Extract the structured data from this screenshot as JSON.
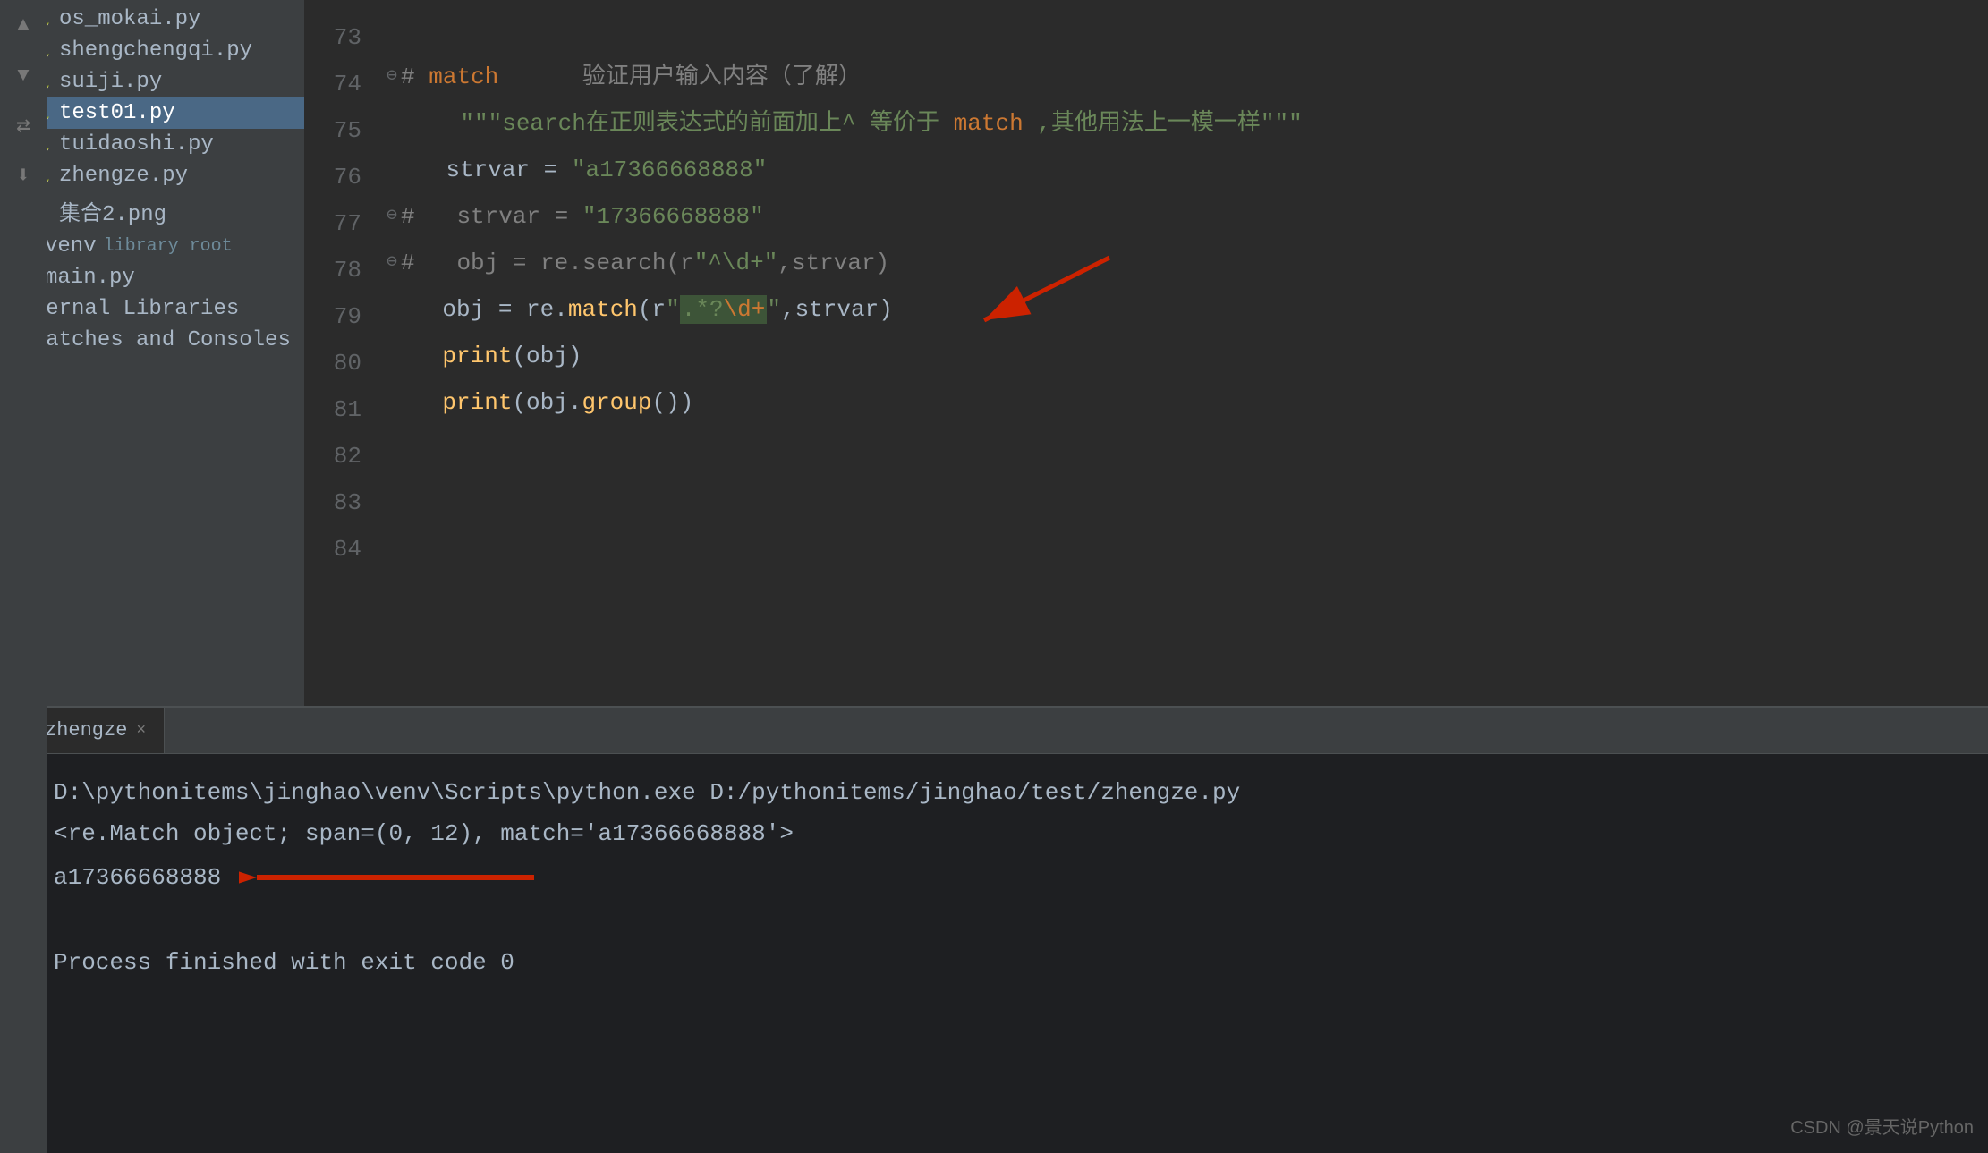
{
  "sidebar": {
    "items": [
      {
        "id": "os-mokai",
        "label": "os_mokai.py",
        "type": "py",
        "indent": 1
      },
      {
        "id": "shengchengqi",
        "label": "shengchengqi.py",
        "type": "py",
        "indent": 1
      },
      {
        "id": "suiji",
        "label": "suiji.py",
        "type": "py",
        "indent": 1
      },
      {
        "id": "test01",
        "label": "test01.py",
        "type": "py",
        "indent": 1,
        "selected": true
      },
      {
        "id": "tuidaoshi",
        "label": "tuidaoshi.py",
        "type": "py",
        "indent": 1
      },
      {
        "id": "zhengze",
        "label": "zhengze.py",
        "type": "py",
        "indent": 1
      },
      {
        "id": "jijhe2",
        "label": "集合2.png",
        "type": "png",
        "indent": 1
      },
      {
        "id": "venv",
        "label": "venv",
        "type": "folder",
        "sublabel": "library root",
        "indent": 0
      },
      {
        "id": "main",
        "label": "main.py",
        "type": "py",
        "indent": 0
      },
      {
        "id": "external-libraries",
        "label": "External Libraries",
        "type": "folder-external",
        "indent": 0
      },
      {
        "id": "scratches",
        "label": "Scratches and Consoles",
        "type": "folder-external",
        "indent": 0
      }
    ]
  },
  "editor": {
    "lines": [
      {
        "num": 73,
        "content": "",
        "type": "empty"
      },
      {
        "num": 74,
        "content": "# match      验证用户输入内容（了解）",
        "type": "comment-line",
        "has_fold": true
      },
      {
        "num": 75,
        "content": "    \"\"\"search在正则表达式的前面加上^ 等价于 match ,其他用法上一模一样\"\"\"",
        "type": "docstring"
      },
      {
        "num": 76,
        "content": "    strvar = \"a17366668888\"",
        "type": "code"
      },
      {
        "num": 77,
        "content": "#   strvar = \"17366668888\"",
        "type": "comment-line",
        "has_fold": true
      },
      {
        "num": 78,
        "content": "#   obj = re.search(r\"^\\d+\",strvar)",
        "type": "comment-line",
        "has_fold": true
      },
      {
        "num": 79,
        "content": "    obj = re.match(r\".*?\\d+\",strvar)",
        "type": "code",
        "has_annotation": true
      },
      {
        "num": 80,
        "content": "    print(obj)",
        "type": "code"
      },
      {
        "num": 81,
        "content": "    print(obj.group())",
        "type": "code"
      },
      {
        "num": 82,
        "content": "",
        "type": "empty"
      },
      {
        "num": 83,
        "content": "",
        "type": "empty"
      },
      {
        "num": 84,
        "content": "",
        "type": "empty"
      }
    ]
  },
  "terminal": {
    "tab_label": "zhengze",
    "tab_close": "×",
    "lines": [
      {
        "text": "D:\\pythonitems\\jinghao\\venv\\Scripts\\python.exe D:/pythonitems/jinghao/test/zhengze.py",
        "type": "path"
      },
      {
        "text": "<re.Match object; span=(0, 12), match='a17366668888'>",
        "type": "output"
      },
      {
        "text": "a17366668888",
        "type": "result",
        "has_arrow": true
      },
      {
        "text": "",
        "type": "empty"
      },
      {
        "text": "Process finished with exit code 0",
        "type": "finished"
      }
    ]
  },
  "watermark": {
    "text": "CSDN @景天说Python"
  },
  "colors": {
    "bg_editor": "#2b2b2b",
    "bg_sidebar": "#3c3f41",
    "bg_terminal": "#1e1f22",
    "accent_blue": "#5d8fc2",
    "text_primary": "#a9b7c6",
    "comment_color": "#808080",
    "string_color": "#6a8759",
    "keyword_color": "#cc7832",
    "function_color": "#ffc66d",
    "number_color": "#6897bb",
    "red_arrow": "#cc2200"
  }
}
